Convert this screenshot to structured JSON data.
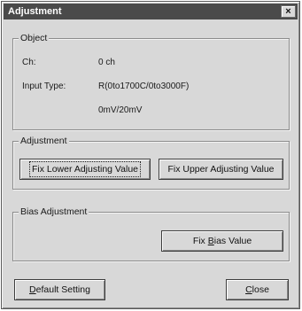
{
  "window": {
    "title": "Adjustment",
    "close_glyph": "×"
  },
  "object_group": {
    "legend": "Object",
    "ch_label": "Ch:",
    "ch_value": "0 ch",
    "input_type_label": "Input Type:",
    "input_type_value": "R(0to1700C/0to3000F)",
    "input_type_value2": "0mV/20mV"
  },
  "adjustment_group": {
    "legend": "Adjustment",
    "fix_lower_label": "Fix Lower Adjusting Value",
    "fix_upper_label": "Fix Upper Adjusting Value"
  },
  "bias_group": {
    "legend": "Bias Adjustment",
    "fix_bias_prefix": "Fix ",
    "fix_bias_accel": "B",
    "fix_bias_suffix": "ias Value"
  },
  "footer": {
    "default_accel": "D",
    "default_rest": "efault Setting",
    "close_accel": "C",
    "close_rest": "lose"
  }
}
